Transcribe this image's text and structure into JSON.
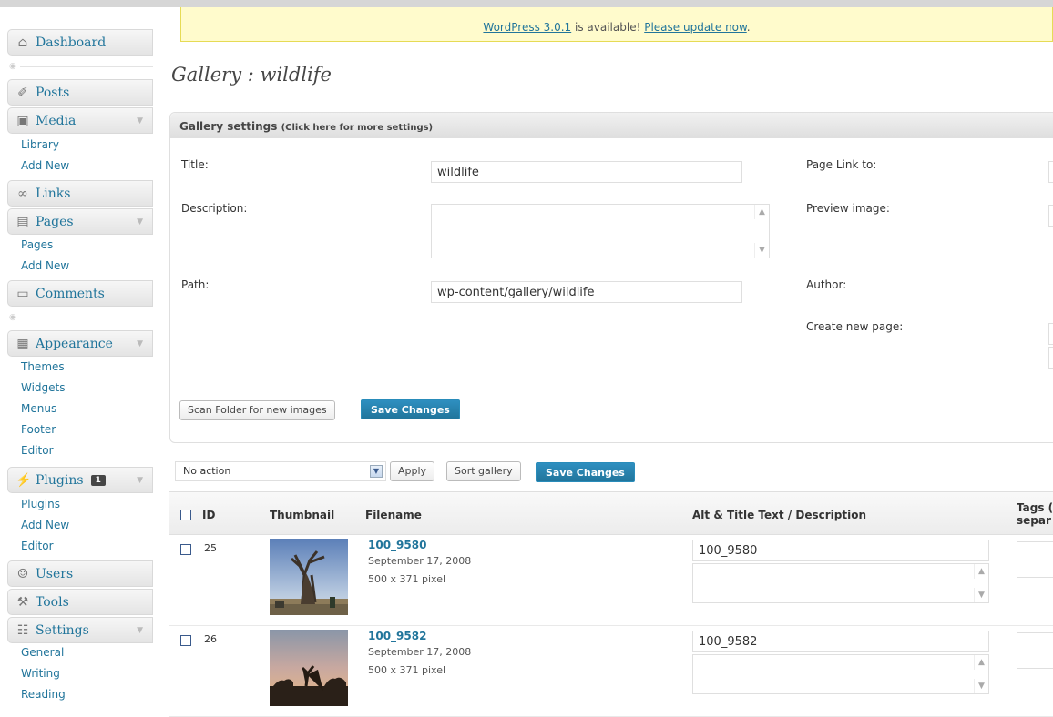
{
  "sidebar": {
    "dashboard": "Dashboard",
    "posts": "Posts",
    "media": {
      "label": "Media",
      "items": [
        "Library",
        "Add New"
      ]
    },
    "links": "Links",
    "pages": {
      "label": "Pages",
      "items": [
        "Pages",
        "Add New"
      ]
    },
    "comments": "Comments",
    "appearance": {
      "label": "Appearance",
      "items": [
        "Themes",
        "Widgets",
        "Menus",
        "Footer",
        "Editor"
      ]
    },
    "plugins": {
      "label": "Plugins",
      "badge": "1",
      "items": [
        "Plugins",
        "Add New",
        "Editor"
      ]
    },
    "users": "Users",
    "tools": "Tools",
    "settings": {
      "label": "Settings",
      "items": [
        "General",
        "Writing",
        "Reading"
      ]
    }
  },
  "notice": {
    "version_link": "WordPress 3.0.1",
    "middle": " is available! ",
    "update_link": "Please update now",
    "end": "."
  },
  "page_title": "Gallery : wildlife",
  "settings_box": {
    "title": "Gallery settings",
    "hint": "(Click here for more settings)",
    "labels": {
      "title": "Title:",
      "description": "Description:",
      "path": "Path:",
      "page_link": "Page Link to:",
      "preview_image": "Preview image:",
      "author": "Author:",
      "create_page": "Create new page:"
    },
    "values": {
      "title": "wildlife",
      "path": "wp-content/gallery/wildlife"
    },
    "scan_button": "Scan Folder for new images",
    "save_button": "Save Changes"
  },
  "bulk": {
    "action_selected": "No action",
    "apply": "Apply",
    "sort": "Sort gallery",
    "save": "Save Changes"
  },
  "table": {
    "headers": {
      "id": "ID",
      "thumbnail": "Thumbnail",
      "filename": "Filename",
      "alt": "Alt & Title Text / Description",
      "tags_line1": "Tags (",
      "tags_line2": "separ"
    },
    "rows": [
      {
        "id": "25",
        "filename": "100_9580",
        "date": "September 17, 2008",
        "size": "500 x 371 pixel",
        "alt": "100_9580"
      },
      {
        "id": "26",
        "filename": "100_9582",
        "date": "September 17, 2008",
        "size": "500 x 371 pixel",
        "alt": "100_9582"
      }
    ]
  },
  "colors": {
    "link": "#21759b",
    "primary_button": "#21759b",
    "notice_bg": "#fffbcc"
  }
}
